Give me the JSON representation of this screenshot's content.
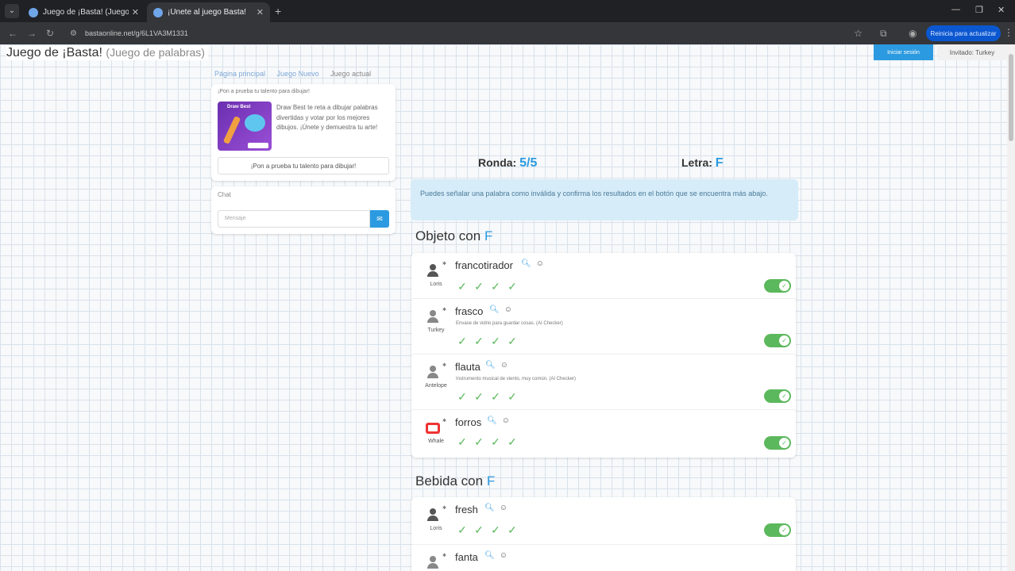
{
  "browser": {
    "tabs": [
      {
        "label": "Juego de ¡Basta! (Juego Stop, Tutti..."
      },
      {
        "label": "¡Únete al juego Basta!"
      }
    ],
    "url": "bastaonline.net/g/6L1VA3M1331",
    "update_label": "Reinicia para actualizar"
  },
  "site": {
    "title": "Juego de ¡Basta!",
    "subtitle": "(Juego de palabras)",
    "new_game_label": "Iniciar sesión",
    "guest_label": "Invitado: Turkey"
  },
  "breadcrumbs": [
    "Página principal",
    "Juego Nuevo",
    "Juego actual"
  ],
  "promo": {
    "title": "¡Pon a prueba tu talento para dibujar!",
    "logo": "Draw Best",
    "text": "Draw Best te reta a dibujar palabras divertidas y votar por los mejores dibujos. ¡Únete y demuestra tu arte!",
    "button": "¡Pon a prueba tu talento para dibujar!"
  },
  "chat": {
    "title": "Chat",
    "placeholder": "Mensaje"
  },
  "game": {
    "round_label": "Ronda:",
    "round_value": "5/5",
    "letter_label": "Letra:",
    "letter_value": "F",
    "alert": "Puedes señalar una palabra como inválida y confirma los resultados en el botón que se encuentra más abajo."
  },
  "categories": [
    {
      "title": "Objeto con",
      "letter": "F",
      "entries": [
        {
          "player": "Loris",
          "word": "francotirador",
          "hint": "",
          "avatar": "person"
        },
        {
          "player": "Turkey",
          "word": "frasco",
          "hint": "Envase de vidrio para guardar cosas. (AI Checker)",
          "avatar": "person-outline"
        },
        {
          "player": "Antelope",
          "word": "flauta",
          "hint": "Instrumento musical de viento, muy común. (AI Checker)",
          "avatar": "person-outline"
        },
        {
          "player": "Whale",
          "word": "forros",
          "hint": "",
          "avatar": "tv"
        }
      ]
    },
    {
      "title": "Bebida con",
      "letter": "F",
      "entries": [
        {
          "player": "Loris",
          "word": "fresh",
          "hint": "",
          "avatar": "person"
        },
        {
          "player": "",
          "word": "fanta",
          "hint": "",
          "avatar": "person-outline"
        }
      ]
    }
  ]
}
